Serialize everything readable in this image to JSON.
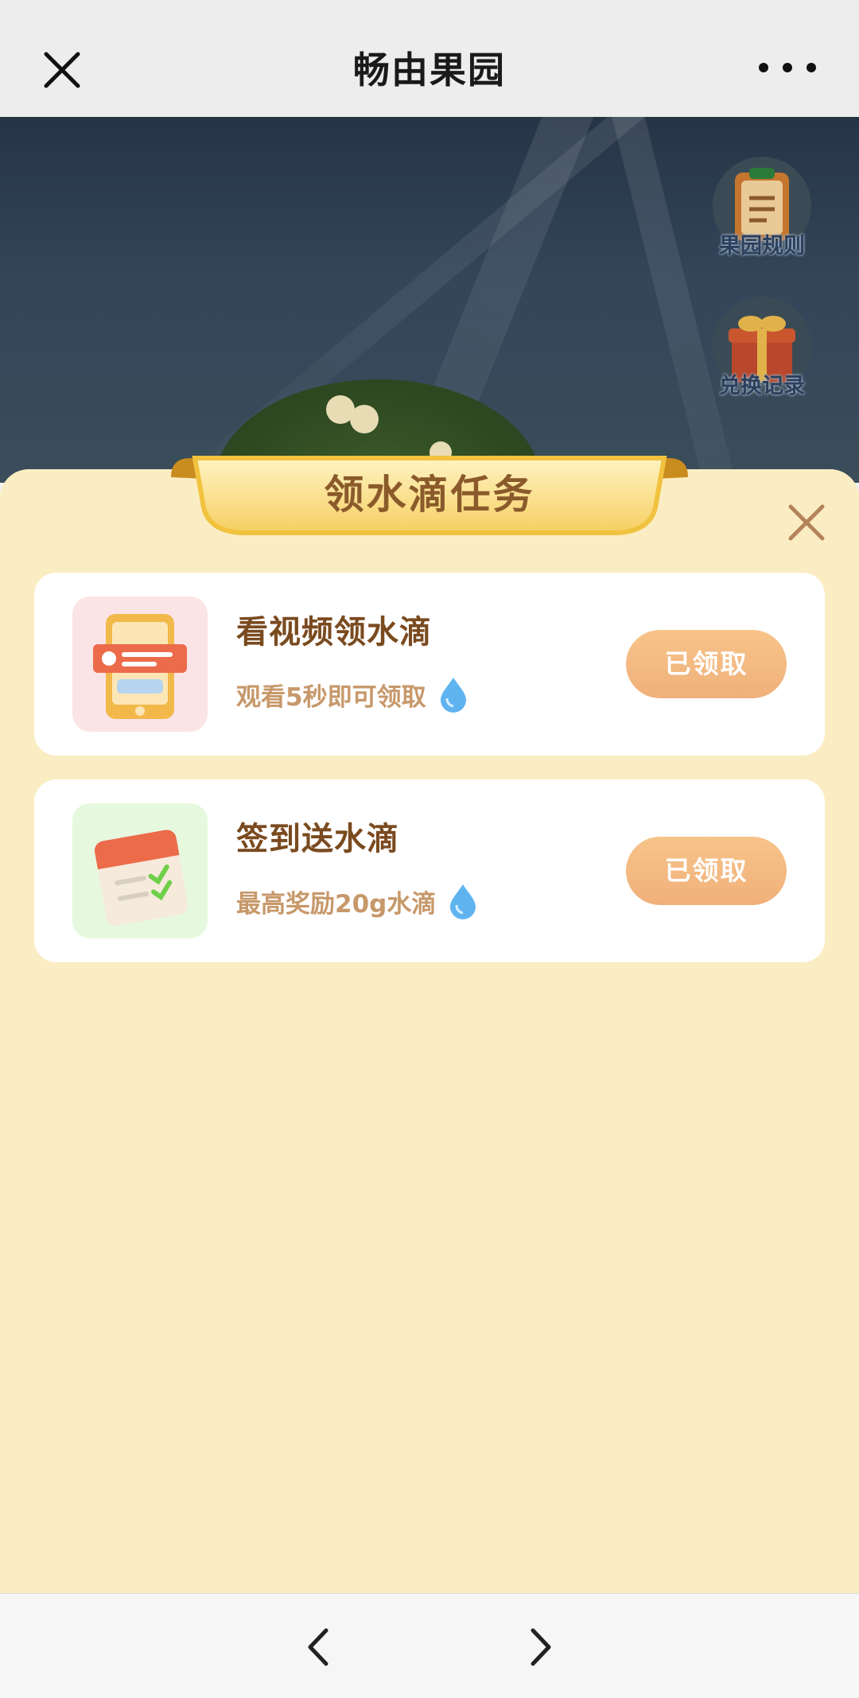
{
  "header": {
    "title": "畅由果园",
    "close_icon": "close-icon",
    "more_icon": "more-icon"
  },
  "scene": {
    "rules_label": "果园规则",
    "exchange_label": "兑换记录"
  },
  "sheet": {
    "title": "领水滴任务",
    "close_icon": "close-icon",
    "tasks": [
      {
        "name": "看视频领水滴",
        "desc": "观看5秒即可领取",
        "button": "已领取",
        "icon": "phone-video-icon",
        "thumb_bg": "#fbe4e6"
      },
      {
        "name": "签到送水滴",
        "desc": "最高奖励20g水滴",
        "button": "已领取",
        "icon": "calendar-check-icon",
        "thumb_bg": "#e6f9de"
      }
    ]
  },
  "footer": {
    "back_icon": "chevron-left-icon",
    "forward_icon": "chevron-right-icon"
  },
  "colors": {
    "sheet_bg": "#fbedc3",
    "button": "#f3b77f",
    "title_text": "#8a5a2b",
    "desc_text": "#c7986a"
  }
}
